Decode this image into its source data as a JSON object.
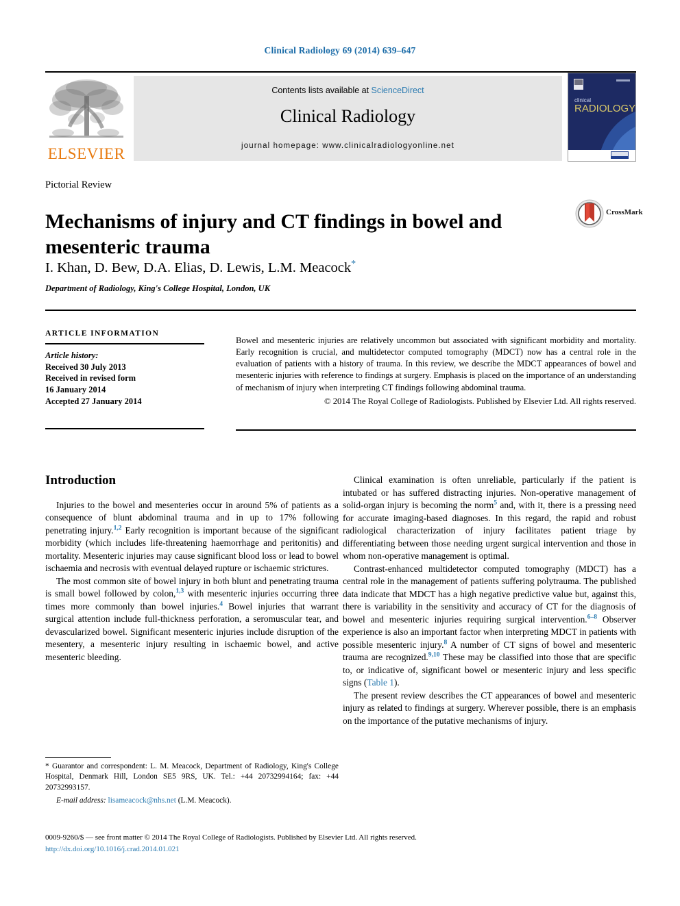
{
  "running_head": "Clinical Radiology 69 (2014) 639–647",
  "masthead": {
    "publisher_name": "ELSEVIER",
    "contents_prefix": "Contents lists available at ",
    "contents_link": "ScienceDirect",
    "journal_name": "Clinical Radiology",
    "homepage_line": "journal homepage: www.clinicalradiologyonline.net",
    "cover_line1": "clinical",
    "cover_line2": "RADIOLOGY",
    "accent_link_color": "#2a7ab0",
    "elsevier_orange": "#e87b10",
    "band_color": "#e6e6e6"
  },
  "article": {
    "kicker": "Pictorial Review",
    "title": "Mechanisms of injury and CT findings in bowel and mesenteric trauma",
    "authors": "I. Khan, D. Bew, D.A. Elias, D. Lewis, L.M. Meacock",
    "author_marker": "*",
    "affiliation": "Department of Radiology, King's College Hospital, London, UK",
    "crossmark_label": "CrossMark"
  },
  "article_info": {
    "heading": "ARTICLE INFORMATION",
    "history_label": "Article history:",
    "history_lines": [
      "Received 30 July 2013",
      "Received in revised form",
      "16 January 2014",
      "Accepted 27 January 2014"
    ]
  },
  "abstract": {
    "text": "Bowel and mesenteric injuries are relatively uncommon but associated with significant morbidity and mortality. Early recognition is crucial, and multidetector computed tomography (MDCT) now has a central role in the evaluation of patients with a history of trauma. In this review, we describe the MDCT appearances of bowel and mesenteric injuries with reference to findings at surgery. Emphasis is placed on the importance of an understanding of mechanism of injury when interpreting CT findings following abdominal trauma.",
    "copyright": "© 2014 The Royal College of Radiologists. Published by Elsevier Ltd. All rights reserved."
  },
  "body": {
    "section_title": "Introduction",
    "left_paragraphs": [
      {
        "pre": "Injuries to the bowel and mesenteries occur in around 5% of patients as a consequence of blunt abdominal trauma and in up to 17% following penetrating injury.",
        "ref": "1,2",
        "post": " Early recognition is important because of the significant morbidity (which includes life-threatening haemorrhage and peritonitis) and mortality. Mesenteric injuries may cause significant blood loss or lead to bowel ischaemia and necrosis with eventual delayed rupture or ischaemic strictures."
      },
      {
        "pre": "The most common site of bowel injury in both blunt and penetrating trauma is small bowel followed by colon,",
        "ref": "1,3",
        "mid": " with mesenteric injuries occurring three times more commonly than bowel injuries.",
        "ref2": "4",
        "post": " Bowel injuries that warrant surgical attention include full-thickness perforation, a seromuscular tear, and devascularized bowel. Significant mesenteric injuries include disruption of the mesentery, a mesenteric injury resulting in ischaemic bowel, and active mesenteric bleeding."
      }
    ],
    "right_paragraphs": [
      {
        "pre": "Clinical examination is often unreliable, particularly if the patient is intubated or has suffered distracting injuries. Non-operative management of solid-organ injury is becoming the norm",
        "ref": "5",
        "post": " and, with it, there is a pressing need for accurate imaging-based diagnoses. In this regard, the rapid and robust radiological characterization of injury facilitates patient triage by differentiating between those needing urgent surgical intervention and those in whom non-operative management is optimal."
      },
      {
        "pre": "Contrast-enhanced multidetector computed tomography (MDCT) has a central role in the management of patients suffering polytrauma. The published data indicate that MDCT has a high negative predictive value but, against this, there is variability in the sensitivity and accuracy of CT for the diagnosis of bowel and mesenteric injuries requiring surgical intervention.",
        "ref": "6–8",
        "mid": " Observer experience is also an important factor when interpreting MDCT in patients with possible mesenteric injury.",
        "ref2": "8",
        "mid2": " A number of CT signs of bowel and mesenteric trauma are recognized.",
        "ref3": "9,10",
        "post": " These may be classified into those that are specific to, or indicative of, significant bowel or mesenteric injury and less specific signs (",
        "xref": "Table 1",
        "tail": ")."
      },
      {
        "pre": "The present review describes the CT appearances of bowel and mesenteric injury as related to findings at surgery. Wherever possible, there is an emphasis on the importance of the putative mechanisms of injury."
      }
    ]
  },
  "footnote": {
    "marker": "*",
    "text": " Guarantor and correspondent: L. M. Meacock, Department of Radiology, King's College Hospital, Denmark Hill, London SE5 9RS, UK. Tel.: +44 20732994164; fax: +44 20732993157.",
    "email_label": "E-mail address:",
    "email": "lisameacock@nhs.net",
    "email_suffix": " (L.M. Meacock)."
  },
  "page_footer": {
    "line": "0009-9260/$ — see front matter © 2014 The Royal College of Radiologists. Published by Elsevier Ltd. All rights reserved.",
    "doi": "http://dx.doi.org/10.1016/j.crad.2014.01.021"
  }
}
